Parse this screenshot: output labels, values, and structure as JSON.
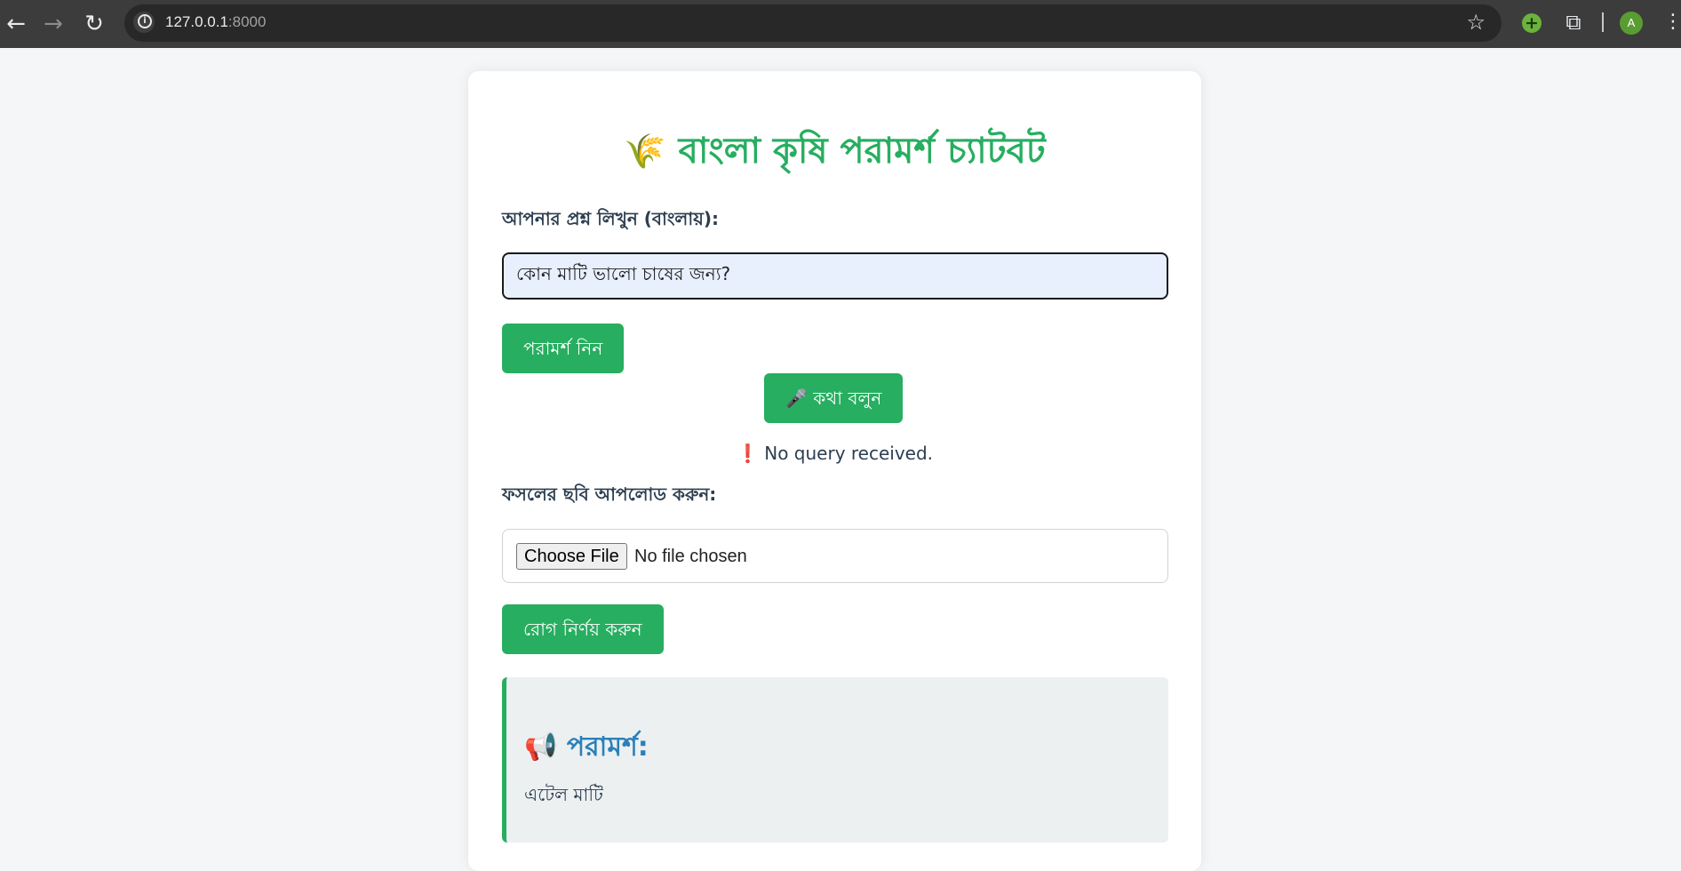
{
  "browser": {
    "url_host": "127.0.0.1",
    "url_port": ":8000",
    "avatar_letter": "A",
    "back_icon": "←",
    "forward_icon": "→",
    "reload_icon": "↻",
    "star_icon": "☆",
    "extension_icon": "+",
    "puzzle_icon": "⧉",
    "menu_icon": "⋮"
  },
  "page": {
    "title_emoji": "🌾",
    "title": "বাংলা কৃষি পরামর্শ চ্যাটবট",
    "question_label": "আপনার প্রশ্ন লিখুন (বাংলায়):",
    "question_value": "কোন মাটি ভালো চাষের জন্য?",
    "advice_button": "পরামর্শ নিন",
    "mic_emoji": "🎤",
    "speak_button": "কথা বলুন",
    "status_mark": "❗",
    "status_text": "No query received.",
    "upload_label": "ফসলের ছবি আপলোড করুন:",
    "choose_file": "Choose File",
    "no_file": "No file chosen",
    "diagnose_button": "রোগ নির্ণয় করুন",
    "result_emoji": "📢",
    "result_title": "পরামর্শ:",
    "result_text": "এটেল মাটি"
  },
  "colors": {
    "brand_green": "#27ae60",
    "text_dark": "#2c3e50",
    "result_blue": "#2b80b9",
    "chrome_dark": "#3c3c3c"
  }
}
